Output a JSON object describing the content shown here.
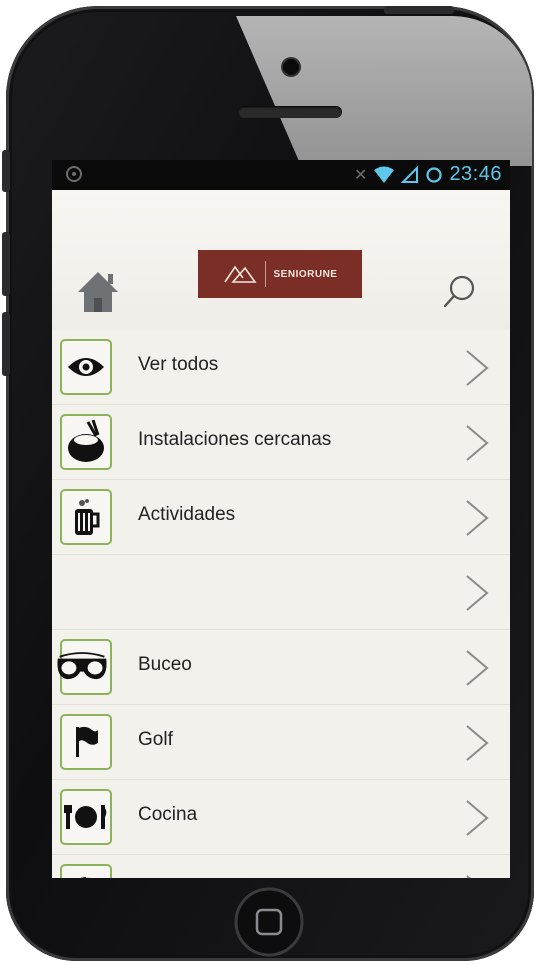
{
  "status_bar": {
    "time": "23:46"
  },
  "header": {
    "logo_text": "SENIORUNE"
  },
  "menu": {
    "items": [
      {
        "label": "Ver todos",
        "icon": "eye-icon"
      },
      {
        "label": "Instalaciones cercanas",
        "icon": "bowl-icon"
      },
      {
        "label": "Actividades",
        "icon": "mug-icon"
      },
      {
        "label": "",
        "icon": ""
      },
      {
        "label": "Buceo",
        "icon": "diving-mask-icon"
      },
      {
        "label": "Golf",
        "icon": "flag-icon"
      },
      {
        "label": "Cocina",
        "icon": "plate-icon"
      },
      {
        "label": "",
        "icon": "pie-icon"
      }
    ]
  },
  "colors": {
    "logo_bg": "#7a2e26",
    "icon_border": "#8cb35a",
    "status_text": "#5fc8ea"
  }
}
